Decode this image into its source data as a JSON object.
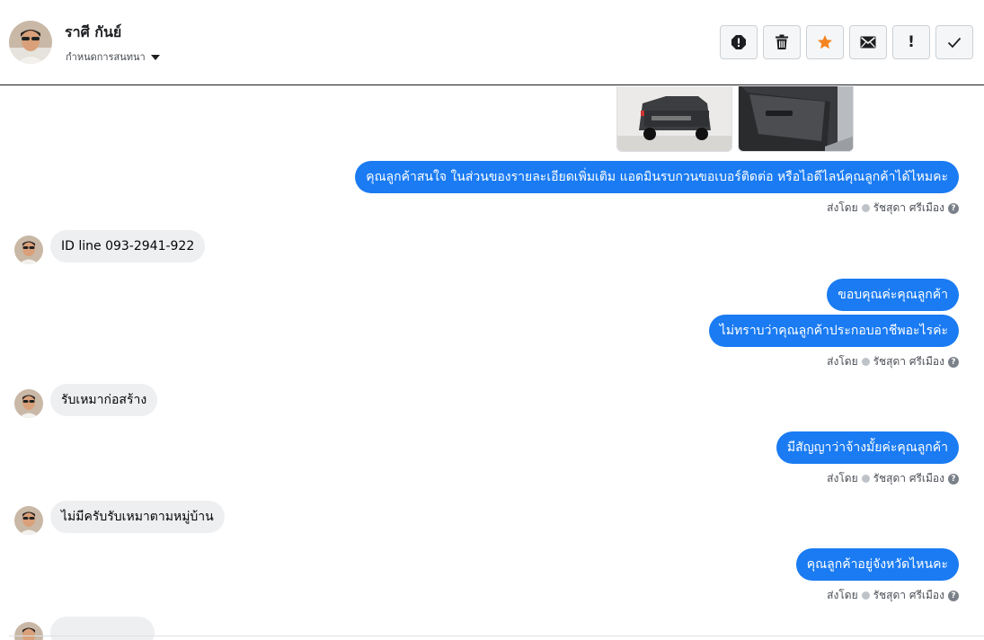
{
  "header": {
    "contact_name": "ราศี กันย์",
    "assign_label": "กำหนดการสนทนา",
    "actions": [
      {
        "name": "spam-button",
        "icon": "alert-circle-icon"
      },
      {
        "name": "delete-button",
        "icon": "trash-icon"
      },
      {
        "name": "star-button",
        "icon": "star-icon",
        "color": "#f5831f"
      },
      {
        "name": "unread-button",
        "icon": "envelope-icon"
      },
      {
        "name": "follow-up-button",
        "icon": "exclamation-icon",
        "glyph": "!"
      },
      {
        "name": "done-button",
        "icon": "checkmark-icon"
      }
    ]
  },
  "colors": {
    "outgoing_bubble": "#1a7bf2",
    "incoming_bubble": "#eeeff1",
    "star": "#f5831f"
  },
  "thread": {
    "attachments": [
      "truck-rear-photo",
      "truck-door-photo"
    ],
    "messages": [
      {
        "dir": "out",
        "text": "คุณลูกค้าสนใจ ในส่วนของรายละเอียดเพิ่มเติม แอดมินรบกวนขอเบอร์ติดต่อ หรือไอดีไลน์คุณลูกค้าได้ไหมคะ"
      },
      {
        "dir": "out-meta",
        "sent_by": "ส่งโดย",
        "agent": "รัชสุดา ศรีเมือง"
      },
      {
        "dir": "in",
        "text": "ID line 093-2941-922"
      },
      {
        "dir": "out",
        "text": "ขอบคุณค่ะคุณลูกค้า"
      },
      {
        "dir": "out",
        "text": "ไม่ทราบว่าคุณลูกค้าประกอบอาชีพอะไรค่ะ"
      },
      {
        "dir": "out-meta",
        "sent_by": "ส่งโดย",
        "agent": "รัชสุดา ศรีเมือง"
      },
      {
        "dir": "in",
        "text": "รับเหมาก่อสร้าง"
      },
      {
        "dir": "out",
        "text": "มีสัญญาว่าจ้างมั้ยค่ะคุณลูกค้า"
      },
      {
        "dir": "out-meta",
        "sent_by": "ส่งโดย",
        "agent": "รัชสุดา ศรีเมือง"
      },
      {
        "dir": "in",
        "text": "ไม่มีครับรับเหมาตามหมู่บ้าน"
      },
      {
        "dir": "out",
        "text": "คุณลูกค้าอยู่จังหวัดไหนคะ"
      },
      {
        "dir": "out-meta",
        "sent_by": "ส่งโดย",
        "agent": "รัชสุดา ศรีเมือง"
      }
    ]
  }
}
